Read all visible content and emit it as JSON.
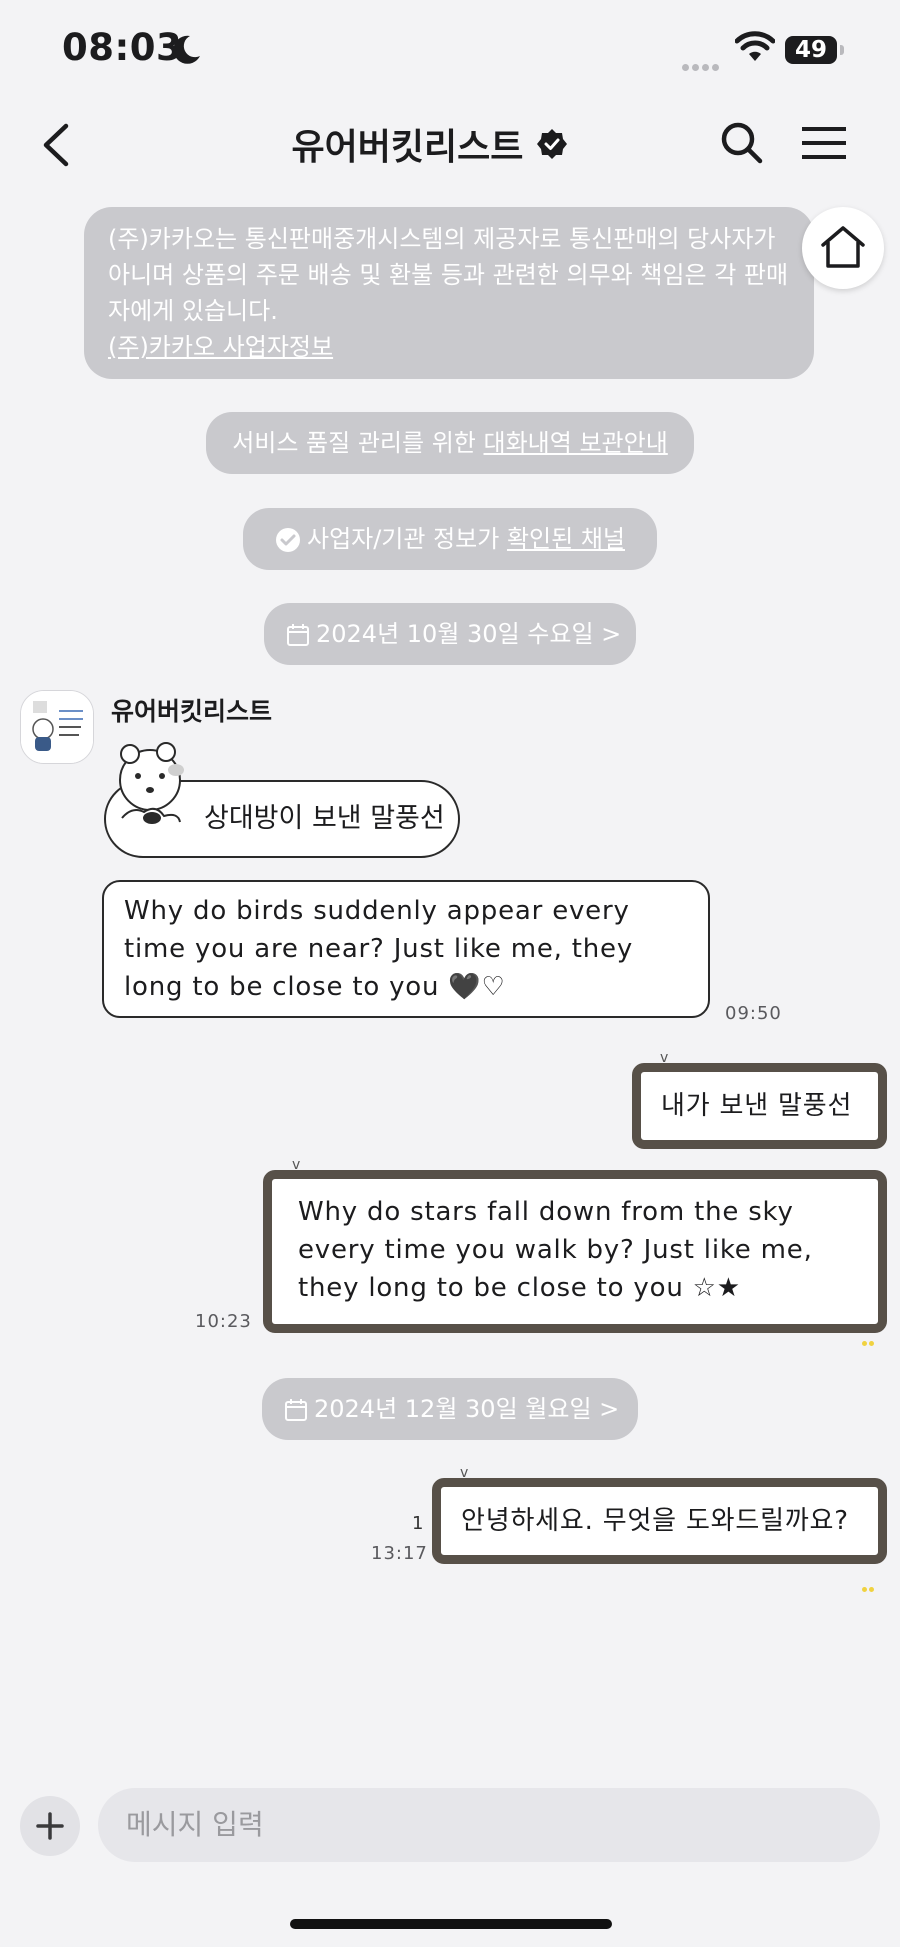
{
  "status_bar": {
    "time": "08:03",
    "battery": "49"
  },
  "header": {
    "title": "유어버킷리스트"
  },
  "notices": {
    "legal_text": "(주)카카오는 통신판매중개시스템의 제공자로 통신판매의 당사자가 아니며 상품의 주문 배송 및 환불 등과 관련한 의무와 책임은 각 판매자에게 있습니다.",
    "legal_link": "(주)카카오 사업자정보",
    "archive_prefix": "서비스 품질 관리를 위한 ",
    "archive_link": "대화내역 보관안내",
    "verified_prefix": "사업자/기관 정보가 ",
    "verified_link": "확인된 채널"
  },
  "dates": {
    "first": "2024년 10월 30일 수요일 >",
    "second": "2024년 12월 30일 월요일 >"
  },
  "sender": {
    "name": "유어버킷리스트"
  },
  "messages": {
    "received_1": "상대방이 보낸 말풍선",
    "received_2": "Why do birds suddenly appear every time you are near? Just like me, they long to be close to you 🖤♡",
    "received_2_time": "09:50",
    "sent_1": "내가 보낸 말풍선",
    "sent_2": "Why do stars fall down from the sky every time you walk by? Just like me, they long to be close to you ☆★",
    "sent_2_time": "10:23",
    "sent_3": "안녕하세요. 무엇을 도와드릴까요?",
    "sent_3_read": "1",
    "sent_3_time": "13:17"
  },
  "composer": {
    "placeholder": "메시지 입력"
  },
  "icons": [
    "back-icon",
    "verified-icon",
    "search-icon",
    "menu-icon",
    "home-icon",
    "check-circle-icon",
    "calendar-icon",
    "plus-icon",
    "wifi-icon",
    "moon-icon"
  ]
}
